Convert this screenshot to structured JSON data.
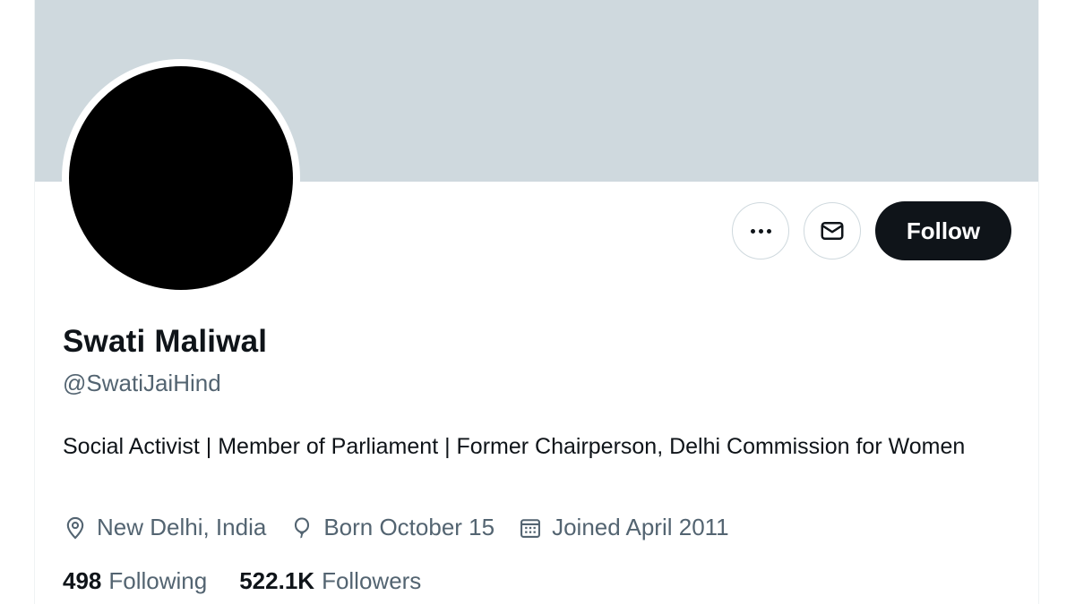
{
  "profile": {
    "name": "Swati Maliwal",
    "handle": "@SwatiJaiHind",
    "bio": "Social Activist | Member of Parliament | Former Chairperson, Delhi Commission for Women",
    "location": "New Delhi, India",
    "birthday": "Born October 15",
    "joined": "Joined April 2011"
  },
  "stats": {
    "following_count": "498",
    "following_label": "Following",
    "followers_count": "522.1K",
    "followers_label": "Followers"
  },
  "actions": {
    "follow_label": "Follow",
    "more_icon": "more-horizontal-icon",
    "message_icon": "envelope-icon"
  },
  "icons": {
    "location": "location-pin-icon",
    "birthday": "balloon-icon",
    "joined": "calendar-icon"
  },
  "colors": {
    "banner": "#cfd9de",
    "primary_text": "#0f1419",
    "secondary_text": "#536471",
    "follow_button_bg": "#0f1419",
    "follow_button_text": "#ffffff"
  }
}
